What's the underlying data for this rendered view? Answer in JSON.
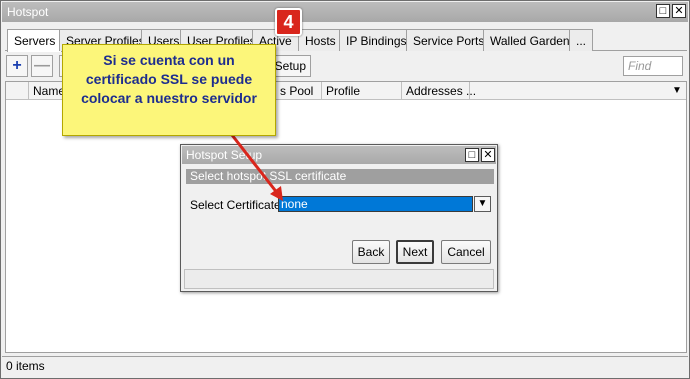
{
  "window": {
    "title": "Hotspot",
    "restore_glyph": "□",
    "close_glyph": "✕"
  },
  "tabs": [
    {
      "label": "Servers",
      "active": true
    },
    {
      "label": "Server Profiles",
      "active": false
    },
    {
      "label": "Users",
      "active": false
    },
    {
      "label": "User Profiles",
      "active": false
    },
    {
      "label": "Active",
      "active": false
    },
    {
      "label": "Hosts",
      "active": false
    },
    {
      "label": "IP Bindings",
      "active": false
    },
    {
      "label": "Service Ports",
      "active": false
    },
    {
      "label": "Walled Garden",
      "active": false
    },
    {
      "label": "...",
      "active": false
    }
  ],
  "toolbar": {
    "add_glyph": "+",
    "remove_glyph": "—",
    "setup_label": "Setup",
    "find_placeholder": "Find"
  },
  "grid": {
    "columns": [
      "Name",
      "s Pool",
      "Profile",
      "Addresses ..."
    ],
    "menu_glyph": "▼"
  },
  "status": {
    "items": "0 items"
  },
  "annotation": {
    "step": "4",
    "callout": "Si se cuenta con un certificado SSL se puede colocar a nuestro servidor",
    "badge_color": "#d9261c",
    "callout_color": "#fcf67a",
    "arrow_color": "#d9261c"
  },
  "dialog": {
    "title": "Hotspot Setup",
    "subtitle": "Select hotspot SSL certificate",
    "field_label": "Select Certificate:",
    "field_value": "none",
    "dropdown_glyph": "▼",
    "back_label": "Back",
    "next_label": "Next",
    "cancel_label": "Cancel"
  }
}
